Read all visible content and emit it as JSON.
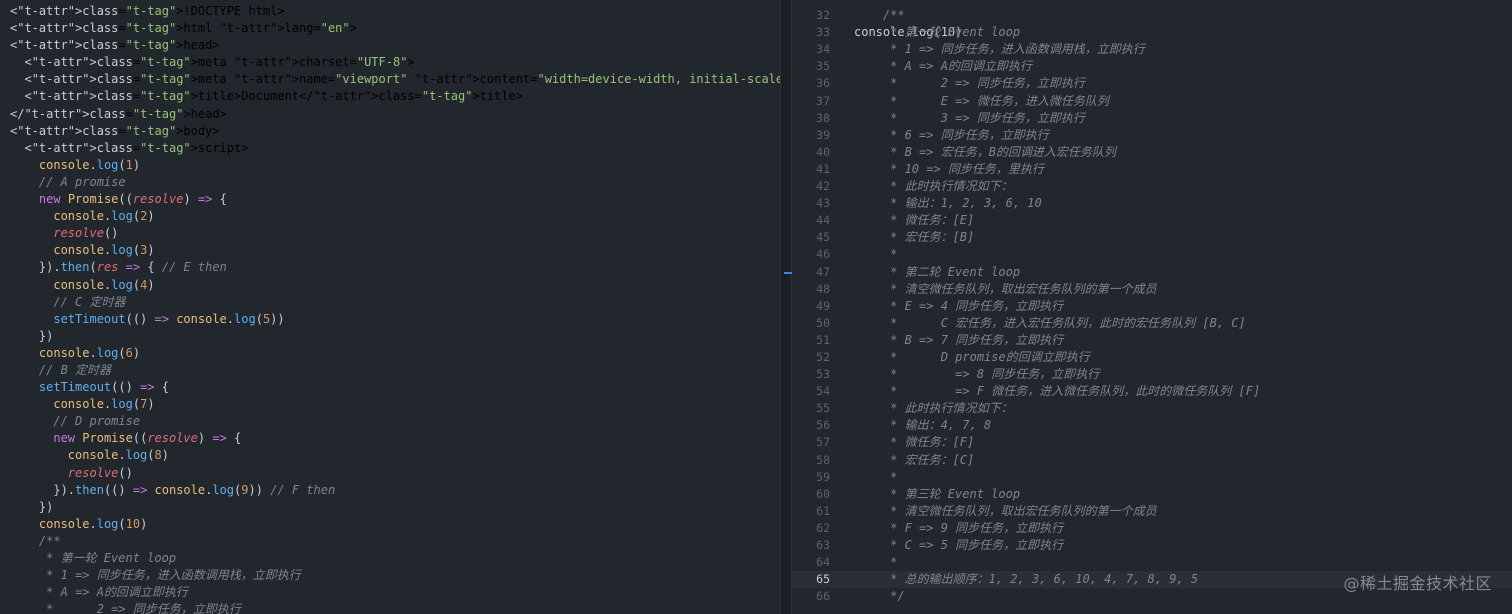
{
  "left_editor": {
    "lines": [
      "<!DOCTYPE html>",
      "<html lang=\"en\">",
      "<head>",
      "  <meta charset=\"UTF-8\">",
      "  <meta name=\"viewport\" content=\"width=device-width, initial-scale=1.0\">",
      "  <title>Document</title>",
      "</head>",
      "<body>",
      "  <script>",
      "    console.log(1)",
      "    // A promise",
      "    new Promise((resolve) => {",
      "      console.log(2)",
      "      resolve()",
      "      console.log(3)",
      "    }).then(res => { // E then",
      "      console.log(4)",
      "      // C 定时器",
      "      setTimeout(() => console.log(5))",
      "    })",
      "    console.log(6)",
      "    // B 定时器",
      "    setTimeout(() => {",
      "      console.log(7)",
      "      // D promise",
      "      new Promise((resolve) => {",
      "        console.log(8)",
      "        resolve()",
      "      }).then(() => console.log(9)) // F then",
      "    })",
      "    console.log(10)",
      "    /**",
      "     * 第一轮 Event loop",
      "     * 1 => 同步任务，进入函数调用栈，立即执行",
      "     * A => A的回调立即执行",
      "     *      2 => 同步任务，立即执行"
    ]
  },
  "right_editor": {
    "top_partial": "console.log(10)",
    "active_line": 65,
    "lines": [
      {
        "n": "32",
        "text": "    /**"
      },
      {
        "n": "33",
        "text": "     * 第一轮 Event loop"
      },
      {
        "n": "34",
        "text": "     * 1 => 同步任务，进入函数调用栈，立即执行"
      },
      {
        "n": "35",
        "text": "     * A => A的回调立即执行"
      },
      {
        "n": "36",
        "text": "     *      2 => 同步任务，立即执行"
      },
      {
        "n": "37",
        "text": "     *      E => 微任务，进入微任务队列"
      },
      {
        "n": "38",
        "text": "     *      3 => 同步任务，立即执行"
      },
      {
        "n": "39",
        "text": "     * 6 => 同步任务，立即执行"
      },
      {
        "n": "40",
        "text": "     * B => 宏任务，B的回调进入宏任务队列"
      },
      {
        "n": "41",
        "text": "     * 10 => 同步任务，里执行"
      },
      {
        "n": "42",
        "text": "     * 此时执行情况如下："
      },
      {
        "n": "43",
        "text": "     * 输出：1, 2, 3, 6, 10"
      },
      {
        "n": "44",
        "text": "     * 微任务：[E]"
      },
      {
        "n": "45",
        "text": "     * 宏任务：[B]"
      },
      {
        "n": "46",
        "text": "     *"
      },
      {
        "n": "47",
        "text": "     * 第二轮 Event loop"
      },
      {
        "n": "48",
        "text": "     * 清空微任务队列，取出宏任务队列的第一个成员"
      },
      {
        "n": "49",
        "text": "     * E => 4 同步任务，立即执行"
      },
      {
        "n": "50",
        "text": "     *      C 宏任务，进入宏任务队列，此时的宏任务队列 [B, C]"
      },
      {
        "n": "51",
        "text": "     * B => 7 同步任务，立即执行"
      },
      {
        "n": "52",
        "text": "     *      D promise的回调立即执行"
      },
      {
        "n": "53",
        "text": "     *        => 8 同步任务，立即执行"
      },
      {
        "n": "54",
        "text": "     *        => F 微任务，进入微任务队列，此时的微任务队列 [F]"
      },
      {
        "n": "55",
        "text": "     * 此时执行情况如下："
      },
      {
        "n": "56",
        "text": "     * 输出：4, 7, 8"
      },
      {
        "n": "57",
        "text": "     * 微任务：[F]"
      },
      {
        "n": "58",
        "text": "     * 宏任务：[C]"
      },
      {
        "n": "59",
        "text": "     *"
      },
      {
        "n": "60",
        "text": "     * 第三轮 Event loop"
      },
      {
        "n": "61",
        "text": "     * 清空微任务队列，取出宏任务队列的第一个成员"
      },
      {
        "n": "62",
        "text": "     * F => 9 同步任务，立即执行"
      },
      {
        "n": "63",
        "text": "     * C => 5 同步任务，立即执行"
      },
      {
        "n": "64",
        "text": "     *"
      },
      {
        "n": "65",
        "text": "     * 总的输出顺序：1, 2, 3, 6, 10, 4, 7, 8, 9, 5"
      },
      {
        "n": "66",
        "text": "     */"
      }
    ]
  },
  "watermark": "@稀土掘金技术社区"
}
